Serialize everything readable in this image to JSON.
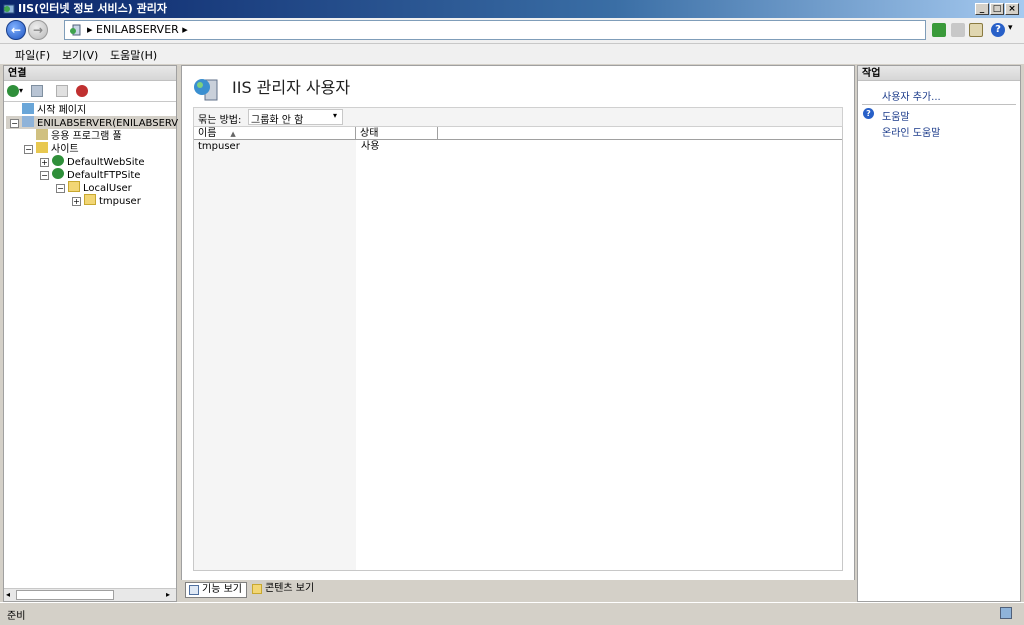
{
  "window": {
    "title": "IIS(인터넷 정보 서비스) 관리자"
  },
  "address": {
    "path": "ENILABSERVER"
  },
  "menu": [
    "파일(F)",
    "보기(V)",
    "도움말(H)"
  ],
  "connections": {
    "header": "연결",
    "tree": [
      "시작 페이지",
      "ENILABSERVER(ENILABSERV",
      "응용 프로그램 풀",
      "사이트",
      "DefaultWebSite",
      "DefaultFTPSite",
      "LocalUser",
      "tmpuser"
    ]
  },
  "main": {
    "title": "IIS 관리자 사용자",
    "group_by_label": "묶는 방법:",
    "group_by_value": "그룹화 안 함",
    "columns": [
      "이름",
      "상태"
    ],
    "rows": [
      {
        "name": "tmpuser",
        "status": "사용"
      }
    ],
    "view_tabs": [
      "기능 보기",
      "콘텐츠 보기"
    ]
  },
  "actions": {
    "header": "작업",
    "add_user": "사용자 추가...",
    "help": "도움말",
    "online_help": "온라인 도움말"
  },
  "status": {
    "text": "준비"
  },
  "colors": {
    "titlebar": "#0a246a",
    "link": "#1a3a8a",
    "globe": "#2f8f3a"
  }
}
